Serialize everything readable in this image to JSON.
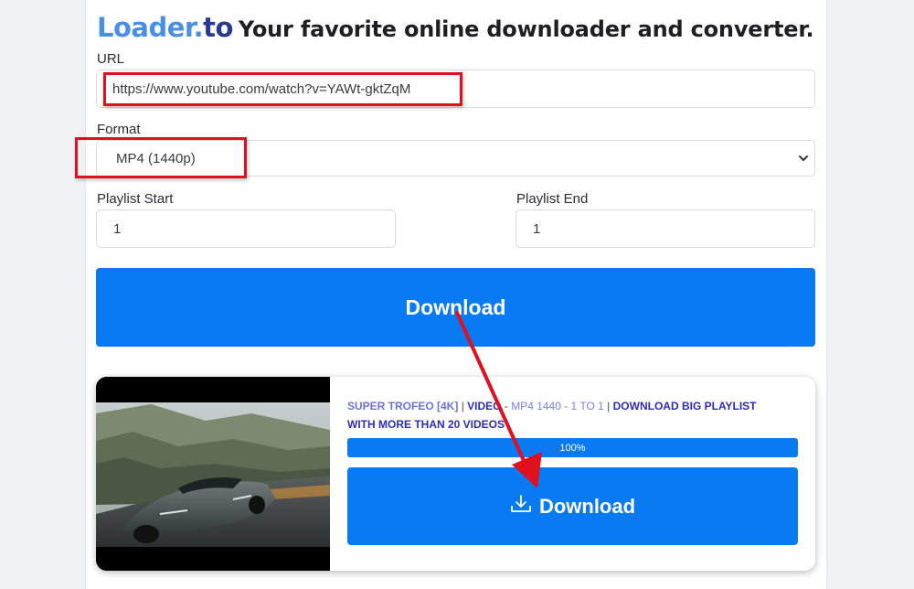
{
  "header": {
    "brand_part1": "Loader.",
    "brand_part2": "to",
    "tagline": "Your favorite online downloader and converter."
  },
  "form": {
    "url_label": "URL",
    "url_value": "https://www.youtube.com/watch?v=YAWt-gktZqM",
    "format_label": "Format",
    "format_value": "MP4 (1440p)",
    "playlist_start_label": "Playlist Start",
    "playlist_start_value": "1",
    "playlist_end_label": "Playlist End",
    "playlist_end_value": "1",
    "download_button": "Download"
  },
  "result": {
    "title": "SUPER TROFEO [4K]",
    "type": "VIDEO",
    "meta": "MP4 1440 - 1 TO 1",
    "link_text": "DOWNLOAD BIG PLAYLIST WITH MORE THAN 20 VIDEOS",
    "progress_text": "100%",
    "progress": 1.0,
    "download_button": "Download"
  },
  "colors": {
    "accent": "#0a7af2",
    "annotation": "#e0101e",
    "brand_light": "#4a90e2",
    "brand_dark": "#2a3a91"
  }
}
